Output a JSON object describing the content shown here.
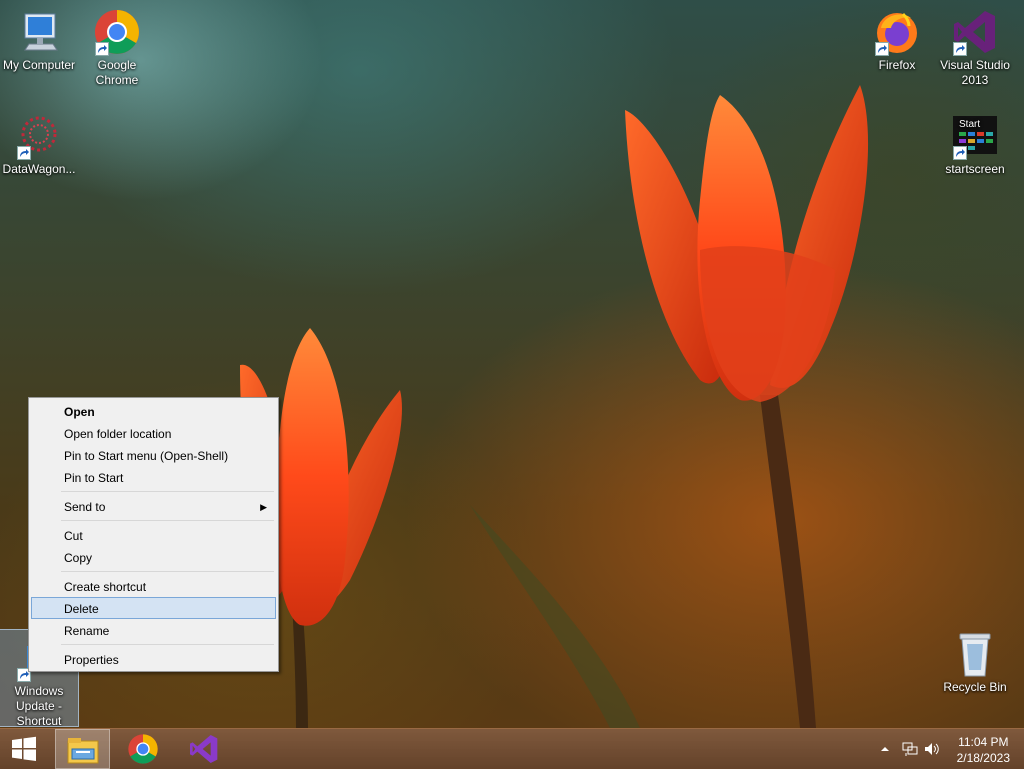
{
  "desktop": {
    "icons": [
      {
        "label": "My Computer",
        "icon": "my-computer-icon"
      },
      {
        "label": "Google Chrome",
        "icon": "chrome-icon"
      },
      {
        "label": "DataWagon...",
        "icon": "datawagon-icon"
      },
      {
        "label": "Firefox",
        "icon": "firefox-icon"
      },
      {
        "label": "Visual Studio 2013",
        "icon": "visual-studio-icon"
      },
      {
        "label": "startscreen",
        "icon": "startscreen-icon",
        "tile_text": "Start"
      },
      {
        "label": "Recycle Bin",
        "icon": "recycle-bin-icon"
      },
      {
        "label": "Windows Update - Shortcut",
        "icon": "windows-update-icon",
        "selected": true
      }
    ]
  },
  "context_menu": {
    "items": [
      {
        "label": "Open",
        "bold": true
      },
      {
        "label": "Open folder location"
      },
      {
        "label": "Pin to Start menu (Open-Shell)"
      },
      {
        "label": "Pin to Start"
      },
      {
        "label": "Send to",
        "submenu": true
      },
      {
        "label": "Cut"
      },
      {
        "label": "Copy"
      },
      {
        "label": "Create shortcut"
      },
      {
        "label": "Delete",
        "highlighted": true
      },
      {
        "label": "Rename"
      },
      {
        "label": "Properties"
      }
    ]
  },
  "taskbar": {
    "buttons": [
      "windows-start-icon",
      "file-explorer-icon",
      "chrome-icon",
      "visual-studio-icon"
    ],
    "tray": {
      "icons": [
        "chevron-up-icon",
        "network-icon",
        "volume-icon"
      ]
    },
    "clock": {
      "time": "11:04 PM",
      "date": "2/18/2023"
    }
  },
  "colors": {
    "menu_highlight": "#d4e3f3",
    "menu_highlight_border": "#7aa7d8",
    "tulip": "#ff4a1a"
  }
}
